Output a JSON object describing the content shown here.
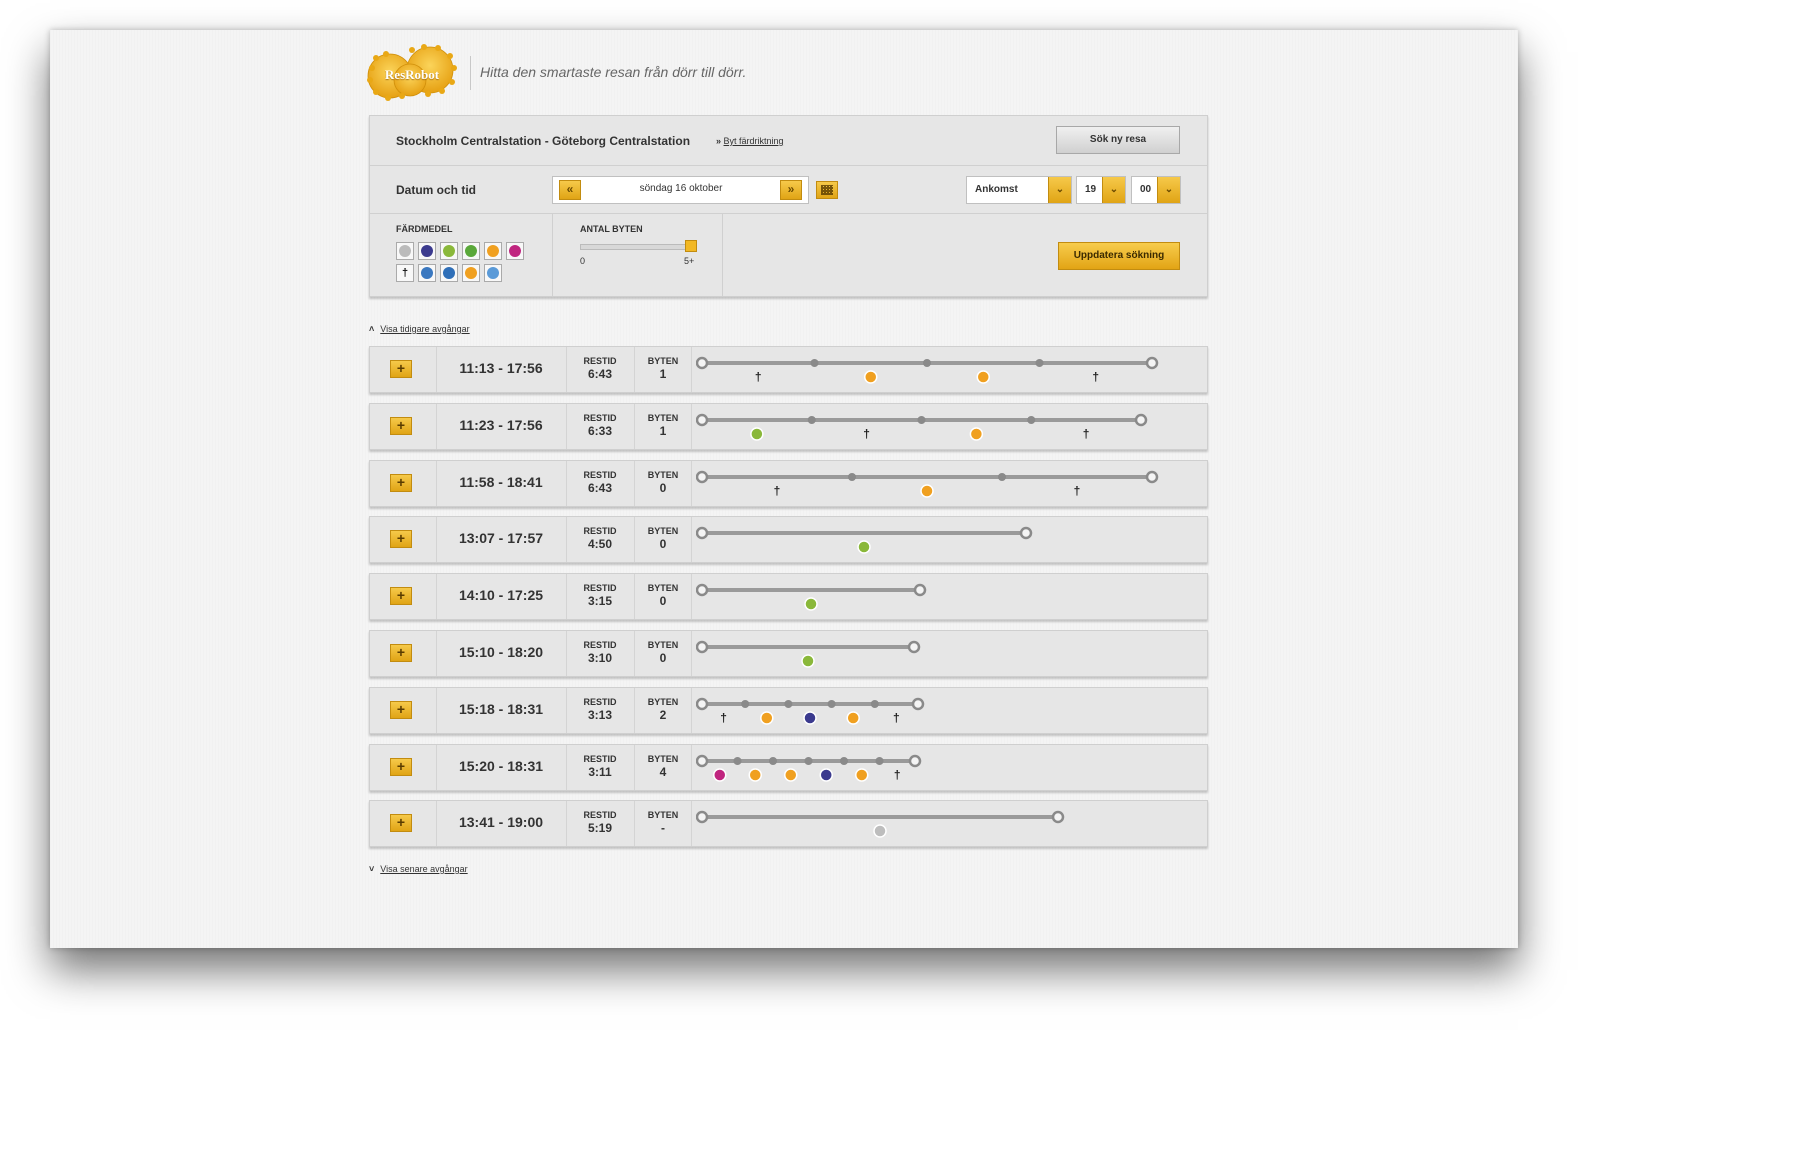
{
  "logo": {
    "text": "ResRobot"
  },
  "tagline": "Hitta den smartaste resan från dörr till dörr.",
  "search": {
    "route_title": "Stockholm Centralstation - Göteborg Centralstation",
    "swap_prefix": "»",
    "swap_label": "Byt färdriktning",
    "new_search_label": "Sök ny resa",
    "date_label": "Datum och tid",
    "prev_label": "«",
    "next_label": "»",
    "date_value": "söndag 16 oktober",
    "mode_select": "Ankomst",
    "hour": "19",
    "minute": "00",
    "arrow": "»"
  },
  "filters": {
    "transport_label": "FÄRDMEDEL",
    "changes_label": "ANTAL BYTEN",
    "changes_min": "0",
    "changes_max": "5+",
    "changes_selected_fraction": 1.0,
    "update_label": "Uppdatera sökning",
    "modes_row1": [
      "bus-icon",
      "airplane-icon",
      "commuter-train-icon",
      "local-train-icon",
      "train-icon",
      "metro-icon"
    ],
    "modes_row2": [
      "walk-icon",
      "tram-icon",
      "regional-train-icon",
      "express-train-icon",
      "ferry-icon"
    ]
  },
  "colors": {
    "accent": "#f2b824",
    "train": "#f0a020",
    "commuter": "#8ab83a",
    "flight": "#3b3a8e",
    "metro": "#c0257f",
    "bus": "#bbbbbb"
  },
  "show_earlier": "Visa tidigare avgångar",
  "show_later": "Visa senare avgångar",
  "trips_header": {
    "restid": "RESTID",
    "byten": "BYTEN",
    "expand": "+"
  },
  "trips": [
    {
      "times": "11:13 - 17:56",
      "restid": "6:43",
      "byten": "1",
      "legs": [
        "walk",
        "train",
        "train",
        "walk"
      ]
    },
    {
      "times": "11:23 - 17:56",
      "restid": "6:33",
      "byten": "1",
      "legs": [
        "commuter",
        "walk",
        "train",
        "walk"
      ]
    },
    {
      "times": "11:58 - 18:41",
      "restid": "6:43",
      "byten": "0",
      "legs": [
        "walk",
        "train",
        "walk"
      ]
    },
    {
      "times": "13:07 - 17:57",
      "restid": "4:50",
      "byten": "0",
      "legs": [
        "commuter"
      ]
    },
    {
      "times": "14:10 - 17:25",
      "restid": "3:15",
      "byten": "0",
      "legs": [
        "commuter"
      ]
    },
    {
      "times": "15:10 - 18:20",
      "restid": "3:10",
      "byten": "0",
      "legs": [
        "commuter"
      ]
    },
    {
      "times": "15:18 - 18:31",
      "restid": "3:13",
      "byten": "2",
      "legs": [
        "walk",
        "train",
        "flight",
        "train",
        "walk"
      ]
    },
    {
      "times": "15:20 - 18:31",
      "restid": "3:11",
      "byten": "4",
      "legs": [
        "metro",
        "train",
        "train",
        "flight",
        "train",
        "walk"
      ]
    },
    {
      "times": "13:41 - 19:00",
      "restid": "5:19",
      "byten": "-",
      "legs": [
        "bus"
      ]
    }
  ]
}
